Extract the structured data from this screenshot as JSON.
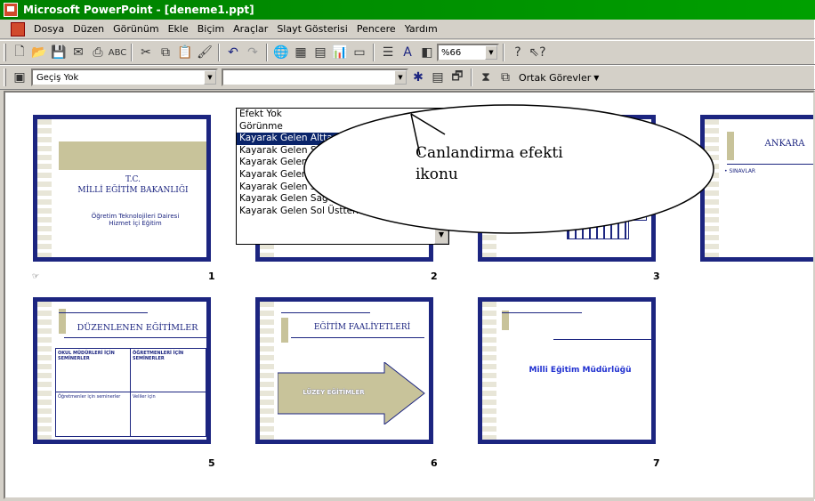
{
  "window": {
    "title": "Microsoft PowerPoint - [deneme1.ppt]"
  },
  "menu": [
    "Dosya",
    "Düzen",
    "Görünüm",
    "Ekle",
    "Biçim",
    "Araçlar",
    "Slayt Gösterisi",
    "Pencere",
    "Yardım"
  ],
  "toolbar": {
    "zoom": "%66"
  },
  "formatting_toolbar": {
    "transition_value": "Geçiş Yok",
    "animation_value": "",
    "ortak_gorevler": "Ortak Görevler"
  },
  "dropdown": {
    "items": [
      "Efekt Yok",
      "Görünme",
      "Kayarak Gelen Alttan",
      "Kayarak Gelen Soldan",
      "Kayarak Gelen Sağdan",
      "Kayarak Gelen Üstten",
      "Kayarak Gelen Sol Alttan",
      "Kayarak Gelen Sağ Alttan",
      "Kayarak Gelen Sol Üstten"
    ],
    "selected_index": 2
  },
  "callout": {
    "line1": "Canlandirma efekti",
    "line2": "ikonu"
  },
  "slides": [
    {
      "number": "1",
      "title": "T.C.\nMİLLİ EĞİTİM BAKANLIĞI",
      "subtitle": "Öğretim Teknolojileri Dairesi\nHizmet İçi Eğitim",
      "transition_icon": "☞"
    },
    {
      "number": "2"
    },
    {
      "number": "3"
    },
    {
      "number": "",
      "title": "ANKARA",
      "subtitle": "• SINAVLAR"
    },
    {
      "number": "5",
      "title": "DÜZENLENEN EĞİTİMLER",
      "cells": [
        "OKUL MÜDÜRLERİ İÇİN SEMİNERLER",
        "ÖĞRETMENLERİ İÇİN SEMİNERLER",
        "Öğretmenler için seminerler",
        "Veliler için"
      ]
    },
    {
      "number": "6",
      "title": "EĞİTİM FAALİYETLERİ",
      "arrow_text": "LÜZEY EĞİTİMLER"
    },
    {
      "number": "7",
      "title": "Milli Eğitim Müdürlüğü"
    }
  ]
}
